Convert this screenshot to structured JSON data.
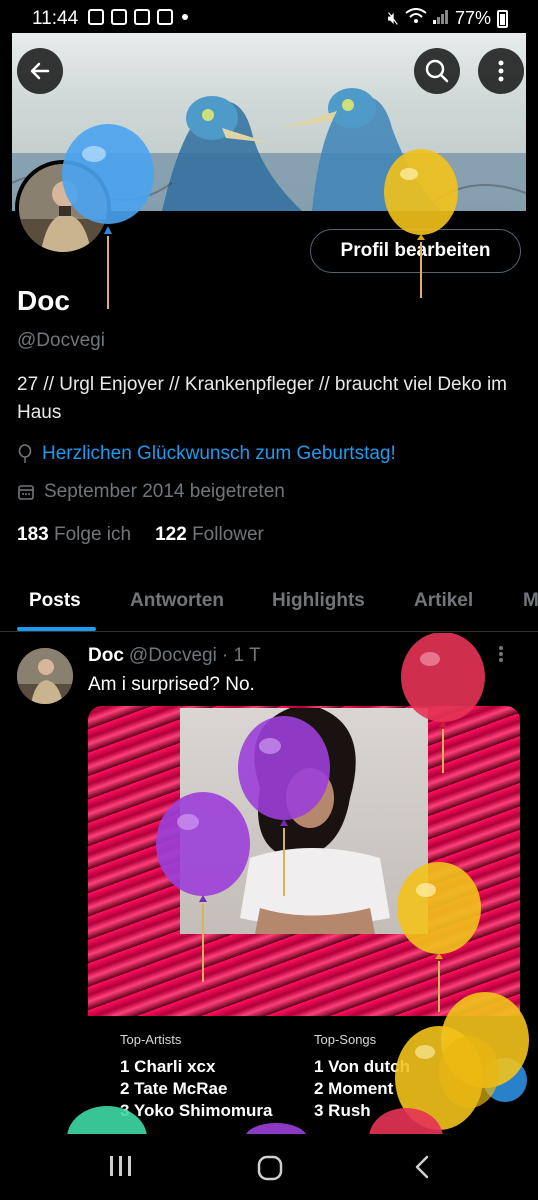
{
  "status_bar": {
    "time": "11:44",
    "battery": "77%"
  },
  "profile": {
    "name": "Doc",
    "handle": "@Docvegi",
    "bio": "27 // Urgl Enjoyer // Krankenpfleger // braucht viel Deko im Haus",
    "birthday_text": "Herzlichen Glückwunsch zum Geburtstag!",
    "joined": "September 2014 beigetreten",
    "following_count": "183",
    "following_label": "Folge ich",
    "followers_count": "122",
    "followers_label": "Follower",
    "edit_button": "Profil bearbeiten"
  },
  "tabs": [
    "Posts",
    "Antworten",
    "Highlights",
    "Artikel",
    "M"
  ],
  "post": {
    "name": "Doc",
    "handle": "@Docvegi",
    "time": "· 1 T",
    "text": "Am i surprised? No.",
    "top_artists_label": "Top-Artists",
    "top_songs_label": "Top-Songs",
    "top_artists": [
      "1  Charli xcx",
      "2  Tate McRae",
      "3  Yoko Shimomura"
    ],
    "top_songs": [
      "1  Von dutch",
      "2  Moment",
      "3  Rush"
    ]
  },
  "icons": {
    "back": "arrow-left-icon",
    "search": "search-icon",
    "more": "more-vertical-icon",
    "location": "balloon-pin-icon",
    "calendar": "calendar-icon"
  },
  "colors": {
    "accent": "#1d9bf0",
    "muted": "#71767b",
    "background": "#000000"
  }
}
